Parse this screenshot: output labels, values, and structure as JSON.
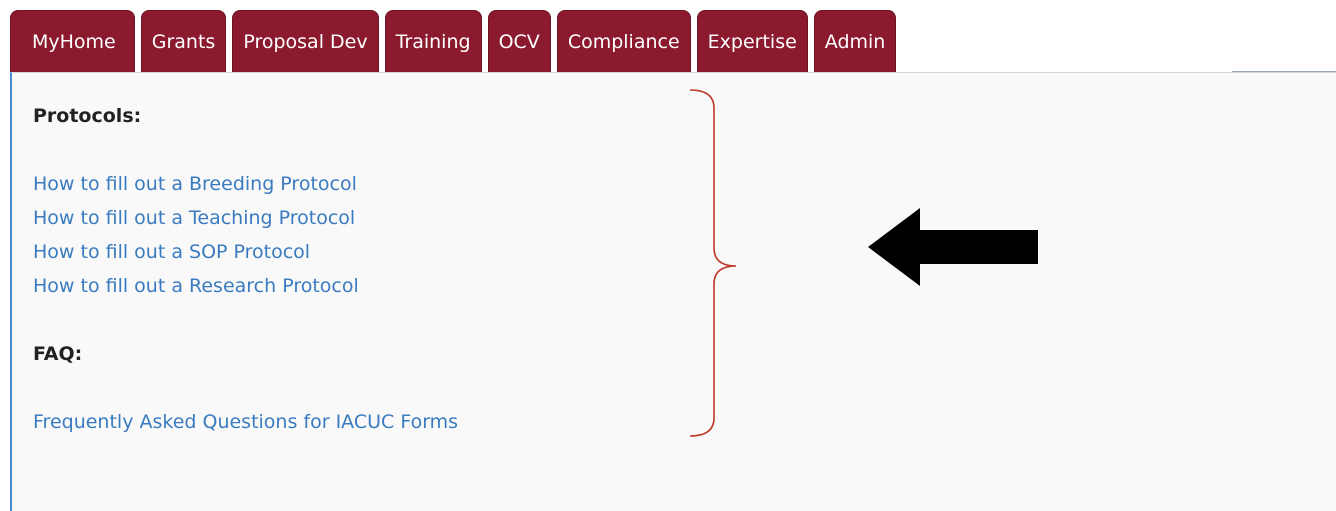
{
  "tabs": [
    {
      "label": "MyHome"
    },
    {
      "label": "Grants"
    },
    {
      "label": "Proposal Dev"
    },
    {
      "label": "Training"
    },
    {
      "label": "OCV"
    },
    {
      "label": "Compliance"
    },
    {
      "label": "Expertise"
    },
    {
      "label": "Admin"
    }
  ],
  "content": {
    "protocols_heading": "Protocols:",
    "protocol_links": [
      "How to fill out a Breeding Protocol",
      "How to fill out a Teaching Protocol",
      "How to fill out a SOP Protocol",
      "How to fill out a Research Protocol"
    ],
    "faq_heading": "FAQ:",
    "faq_links": [
      "Frequently Asked Questions for IACUC Forms"
    ]
  },
  "colors": {
    "tab_background": "#8b1a2e",
    "link": "#3a7bc0",
    "annotation_bracket": "#c0392b",
    "annotation_arrow": "#000000"
  },
  "icons": {
    "bracket": "right-curly-brace",
    "arrow": "left-arrow"
  }
}
